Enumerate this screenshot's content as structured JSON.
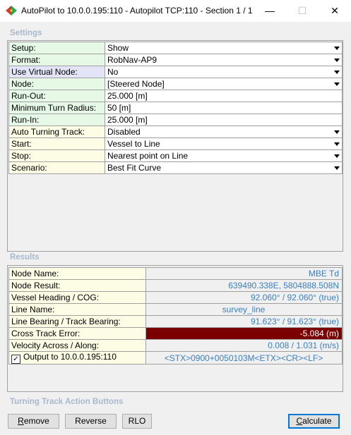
{
  "window": {
    "title": "AutoPilot to 10.0.0.195:110 - Autopilot TCP:110 - Section 1 / 1",
    "min_glyph": "—",
    "max_glyph": "☐",
    "close_glyph": "✕"
  },
  "settings": {
    "heading": "Settings",
    "rows": [
      {
        "label": "Setup:",
        "value": "Show",
        "dropdown": true,
        "tone": "green"
      },
      {
        "label": "Format:",
        "value": "RobNav-AP9",
        "dropdown": true,
        "tone": "green"
      },
      {
        "label": "Use Virtual Node:",
        "value": "No",
        "dropdown": true,
        "tone": "blue"
      },
      {
        "label": "Node:",
        "value": "[Steered Node]",
        "dropdown": true,
        "tone": "green"
      },
      {
        "label": "Run-Out:",
        "value": "25.000 [m]",
        "dropdown": false,
        "tone": "green"
      },
      {
        "label": "Minimum Turn Radius:",
        "value": "50 [m]",
        "dropdown": false,
        "tone": "green"
      },
      {
        "label": "Run-In:",
        "value": "25.000 [m]",
        "dropdown": false,
        "tone": "green"
      },
      {
        "label": "Auto Turning Track:",
        "value": "Disabled",
        "dropdown": true,
        "tone": "yellow"
      },
      {
        "label": "Start:",
        "value": "Vessel to Line",
        "dropdown": true,
        "tone": "yellow"
      },
      {
        "label": "Stop:",
        "value": "Nearest point on Line",
        "dropdown": true,
        "tone": "yellow"
      },
      {
        "label": "Scenario:",
        "value": "Best Fit Curve",
        "dropdown": true,
        "tone": "yellow"
      }
    ]
  },
  "results": {
    "heading": "Results",
    "rows": [
      {
        "label": "Node Name:",
        "value": "MBE Td",
        "style": ""
      },
      {
        "label": "Node Result:",
        "value": "639490.338E, 5804888.508N",
        "style": ""
      },
      {
        "label": "Vessel Heading / COG:",
        "value": "92.060° / 92.060° (true)",
        "style": ""
      },
      {
        "label": "Line Name:",
        "value": "survey_line",
        "style": "center"
      },
      {
        "label": "Line Bearing / Track Bearing:",
        "value": "91.623° / 91.623° (true)",
        "style": ""
      },
      {
        "label": "Cross Track Error:",
        "value": "-5.084 (m)",
        "style": "err"
      },
      {
        "label": "Velocity Across / Along:",
        "value": "0.008 / 1.031 (m/s)",
        "style": ""
      },
      {
        "label": "Output to 10.0.0.195:110",
        "value": "<STX>0900+0050103M<ETX><CR><LF>",
        "style": "center",
        "checkbox": true,
        "checked": true
      }
    ]
  },
  "actions": {
    "heading": "Turning Track Action Buttons",
    "remove": "Remove",
    "reverse": "Reverse",
    "rlo": "RLO",
    "calculate": "Calculate"
  },
  "colors": {
    "error_bg": "#7b0000",
    "value_text": "#3a7fc0",
    "section_heading": "#a8b8cc"
  }
}
